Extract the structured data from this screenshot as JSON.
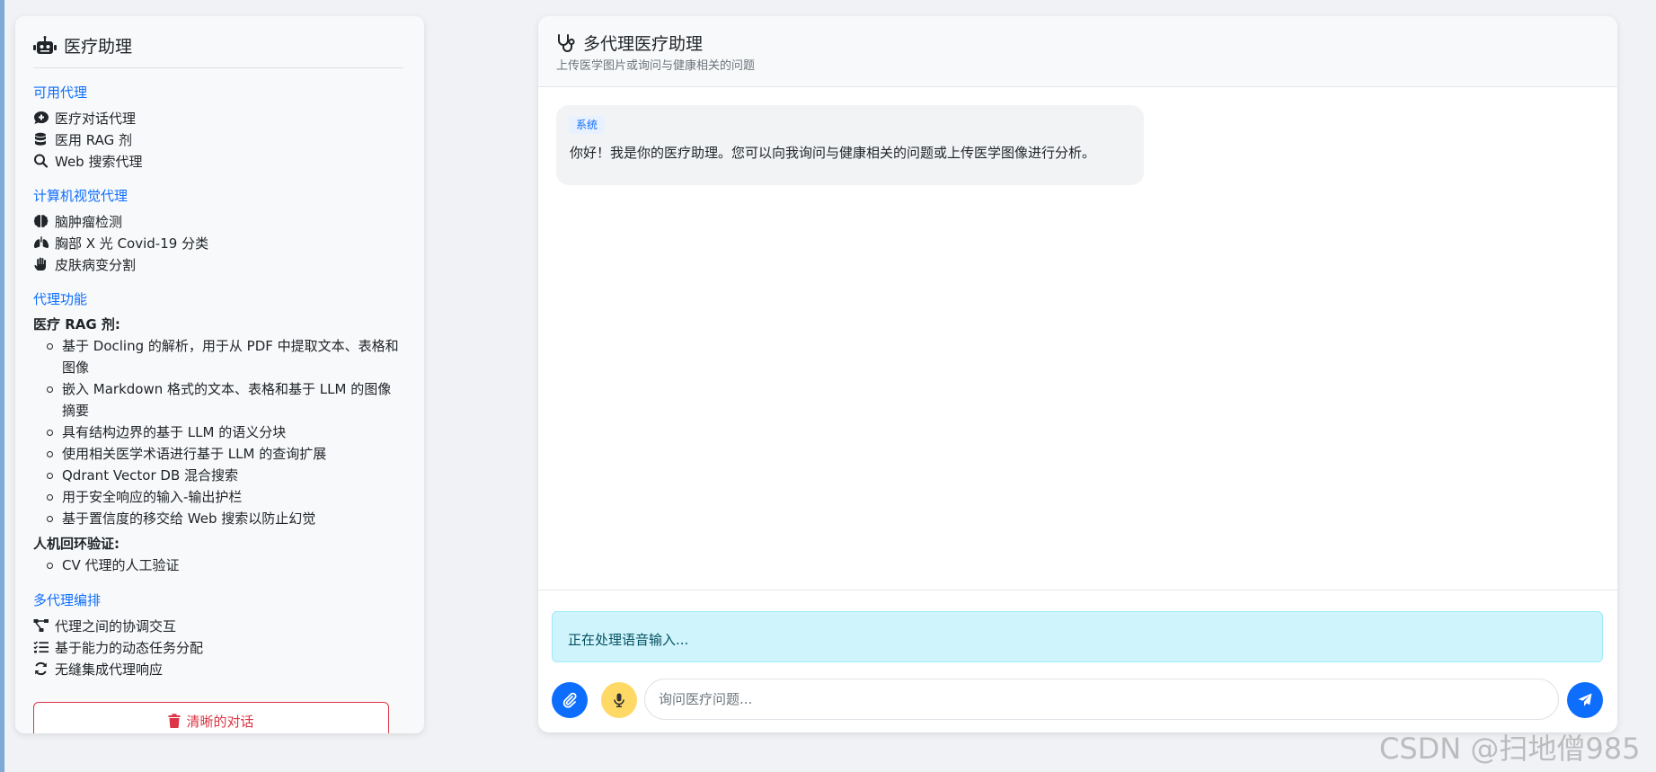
{
  "sidebar": {
    "title": "医疗助理",
    "available_agents": {
      "heading": "可用代理",
      "items": [
        {
          "icon": "comment-medical-icon",
          "label": "医疗对话代理"
        },
        {
          "icon": "database-icon",
          "label": "医用 RAG 剂"
        },
        {
          "icon": "search-icon",
          "label": "Web 搜索代理"
        }
      ]
    },
    "cv_agents": {
      "heading": "计算机视觉代理",
      "items": [
        {
          "icon": "brain-icon",
          "label": "脑肿瘤检测"
        },
        {
          "icon": "lungs-icon",
          "label": "胸部 X 光 Covid-19 分类"
        },
        {
          "icon": "hand-icon",
          "label": "皮肤病变分割"
        }
      ]
    },
    "agent_features": {
      "heading": "代理功能",
      "rag_title": "医疗 RAG 剂:",
      "rag_items": [
        "基于 Docling 的解析，用于从 PDF 中提取文本、表格和图像",
        "嵌入 Markdown 格式的文本、表格和基于 LLM 的图像摘要",
        "具有结构边界的基于 LLM 的语义分块",
        "使用相关医学术语进行基于 LLM 的查询扩展",
        "Qdrant Vector DB 混合搜索",
        "用于安全响应的输入-输出护栏",
        "基于置信度的移交给 Web 搜索以防止幻觉"
      ],
      "hitl_title": "人机回环验证:",
      "hitl_items": [
        "CV 代理的人工验证"
      ]
    },
    "orchestration": {
      "heading": "多代理编排",
      "items": [
        {
          "icon": "project-diagram-icon",
          "label": "代理之间的协调交互"
        },
        {
          "icon": "tasks-icon",
          "label": "基于能力的动态任务分配"
        },
        {
          "icon": "sync-icon",
          "label": "无缝集成代理响应"
        }
      ]
    },
    "clear_button": "清晰的对话"
  },
  "chat": {
    "title": "多代理医疗助理",
    "subtitle": "上传医学图片或询问与健康相关的问题",
    "messages": [
      {
        "role": "系统",
        "text": "你好！我是你的医疗助理。您可以向我询问与健康相关的问题或上传医学图像进行分析。"
      }
    ],
    "status": "正在处理语音输入...",
    "input_placeholder": "询问医疗问题..."
  },
  "watermark": "CSDN @扫地僧985",
  "colors": {
    "primary": "#0d6efd",
    "danger": "#dc3545",
    "info_bg": "#cff4fc",
    "mic": "#ffd966"
  }
}
